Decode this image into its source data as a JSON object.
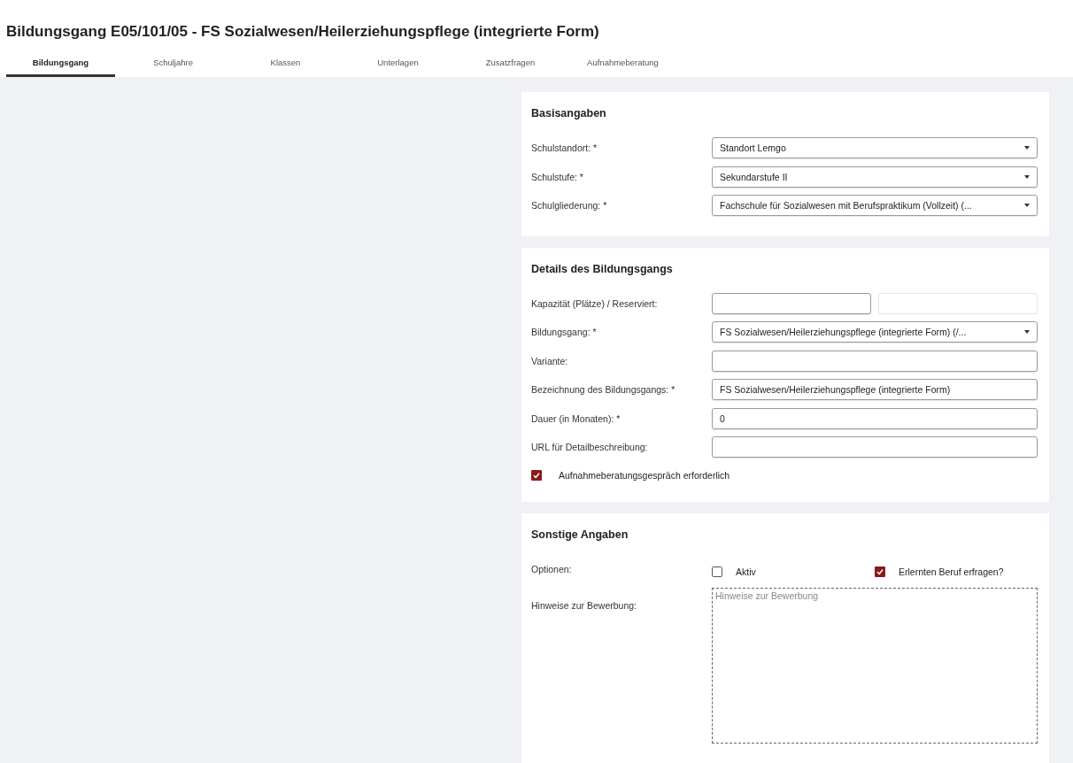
{
  "title": "Bildungsgang E05/101/05 - FS Sozialwesen/Heilerziehungspflege (integrierte Form)",
  "tabs": [
    {
      "label": "Bildungsgang",
      "selected": true
    },
    {
      "label": "Schuljahre",
      "selected": false
    },
    {
      "label": "Klassen",
      "selected": false
    },
    {
      "label": "Unterlagen",
      "selected": false
    },
    {
      "label": "Zusatzfragen",
      "selected": false
    },
    {
      "label": "Aufnahmeberatung",
      "selected": false
    }
  ],
  "sections": [
    {
      "title": "Basisangaben",
      "rows": [
        {
          "kind": "select",
          "label": "Schulstandort: *",
          "value": "Standort Lemgo"
        },
        {
          "kind": "select",
          "label": "Schulstufe: *",
          "value": "Sekundarstufe II"
        },
        {
          "kind": "select",
          "label": "Schulgliederung: *",
          "value": "Fachschule für Sozialwesen mit Berufspraktikum (Vollzeit) (..."
        }
      ]
    },
    {
      "title": "Details des Bildungsgangs",
      "rows": [
        {
          "kind": "pair",
          "label": "Kapazität (Plätze) / Reserviert:",
          "fields": [
            {
              "disabled": false
            },
            {
              "disabled": true
            }
          ]
        },
        {
          "kind": "select",
          "label": "Bildungsgang: *",
          "value": "FS Sozialwesen/Heilerziehungspflege (integrierte Form) (/..."
        },
        {
          "kind": "input",
          "label": "Variante:"
        },
        {
          "kind": "input",
          "label": "Bezeichnung des Bildungsgangs: *",
          "value": "FS Sozialwesen/Heilerziehungspflege (integrierte Form)"
        },
        {
          "kind": "input",
          "label": "Dauer (in Monaten): *",
          "value": "0"
        },
        {
          "kind": "input",
          "label": "URL für Detailbeschreibung:"
        },
        {
          "kind": "checkbox",
          "label": "Aufnahmeberatungsgespräch erforderlich",
          "checked": true
        }
      ]
    },
    {
      "title": "Sonstige Angaben",
      "rows": [
        {
          "kind": "options",
          "label": "Optionen:",
          "options": [
            {
              "label": "Aktiv",
              "checked": false
            },
            {
              "label": "Erlernten Beruf erfragen?",
              "checked": true
            }
          ]
        },
        {
          "kind": "textarea",
          "label": "Hinweise zur Bewerbung:",
          "placeholder": "Hinweise zur Bewerbung"
        }
      ]
    }
  ]
}
